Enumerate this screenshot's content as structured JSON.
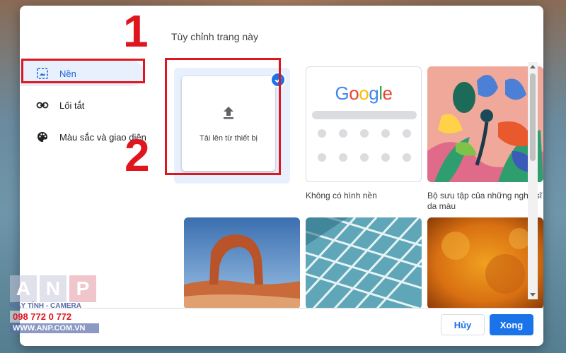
{
  "dialog": {
    "title": "Tùy chỉnh trang này",
    "cancel_label": "Hủy",
    "done_label": "Xong"
  },
  "sidebar": {
    "items": [
      {
        "label": "Nền",
        "icon": "image-icon",
        "active": true
      },
      {
        "label": "Lối tắt",
        "icon": "link-icon",
        "active": false
      },
      {
        "label": "Màu sắc và giao diện",
        "icon": "palette-icon",
        "active": false
      }
    ]
  },
  "tiles": {
    "upload_label": "Tải lên từ thiết bị",
    "google_logo": "Google",
    "no_background_caption": "Không có hình nền",
    "artist_caption": "Bộ sưu tập của những nghệ sĩ da màu"
  },
  "annotations": {
    "step1": "1",
    "step2": "2",
    "highlight_color": "#e0161e"
  },
  "watermark": {
    "letters": [
      "A",
      "N",
      "P"
    ],
    "tagline": "MÁY TÍNH - CAMERA",
    "phone": "098 772 0 772",
    "website": "WWW.ANP.COM.VN"
  },
  "colors": {
    "accent": "#1a73e8",
    "active_bg": "#e8f0fe"
  }
}
